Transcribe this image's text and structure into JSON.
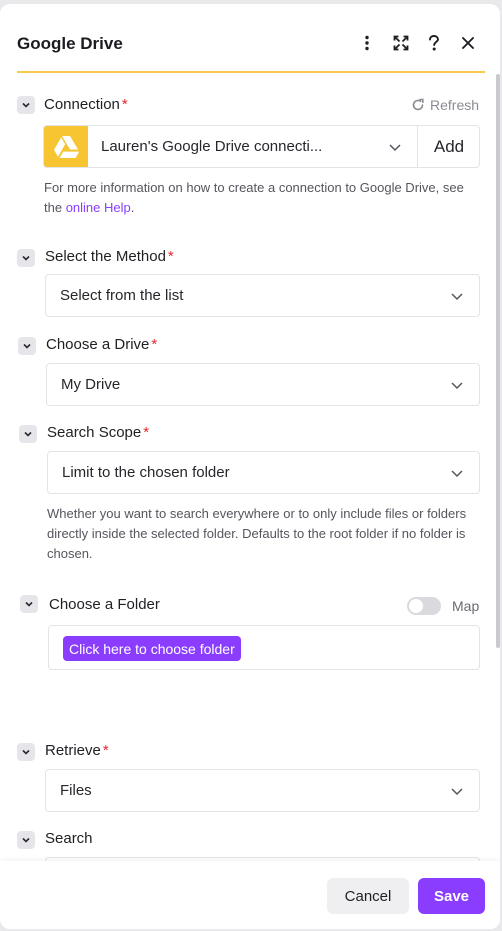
{
  "modal": {
    "title": "Google Drive",
    "icons": {
      "more": "more-vertical-icon",
      "expand": "expand-icon",
      "help": "help-icon",
      "close": "close-icon"
    }
  },
  "connection": {
    "label": "Connection",
    "required_mark": "*",
    "refresh_label": "Refresh",
    "value": "Lauren's Google Drive connecti...",
    "add_label": "Add",
    "help_prefix": "For more information on how to create a connection to Google Drive, see the ",
    "help_link": "online Help",
    "help_suffix": "."
  },
  "method": {
    "label": "Select the Method",
    "required_mark": "*",
    "value": "Select from the list"
  },
  "drive": {
    "label": "Choose a Drive",
    "required_mark": "*",
    "value": "My Drive"
  },
  "scope": {
    "label": "Search Scope",
    "required_mark": "*",
    "value": "Limit to the chosen folder",
    "help": "Whether you want to search everywhere or to only include files or folders directly inside the selected folder. Defaults to the root folder if no folder is chosen."
  },
  "folder": {
    "label": "Choose a Folder",
    "map_label": "Map",
    "map_enabled": false,
    "button_label": "Click here to choose folder"
  },
  "retrieve": {
    "label": "Retrieve",
    "required_mark": "*",
    "value": "Files"
  },
  "search": {
    "label": "Search"
  },
  "footer": {
    "cancel_label": "Cancel",
    "save_label": "Save"
  },
  "colors": {
    "accent": "#8b3dff",
    "header_underline": "#f6c94a",
    "required": "#e5272e",
    "drive_logo_bg": "#f7c531"
  }
}
